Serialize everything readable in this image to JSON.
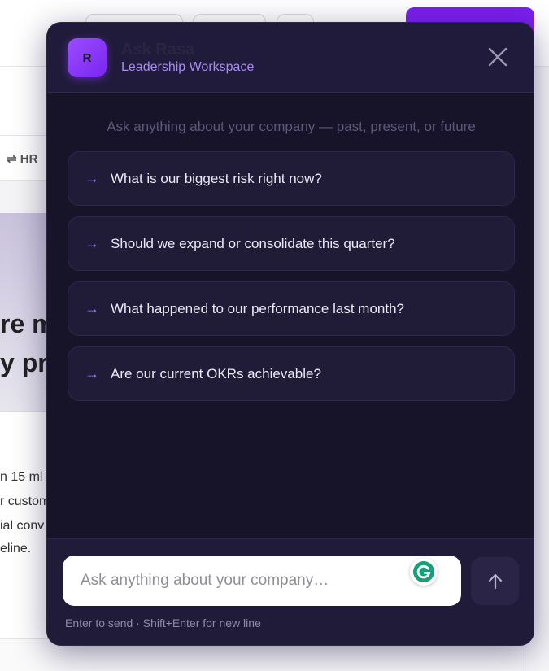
{
  "background": {
    "tab_label": "⇌ HR",
    "hero_lines": [
      "re m",
      "y pr"
    ],
    "body_lines": [
      "n 15 mi",
      "r custom",
      "ial conv",
      "eline."
    ]
  },
  "modal": {
    "avatar_letter": "R",
    "title": "Ask Rasa",
    "subtitle": "Leadership Workspace",
    "intro": "Ask anything about your company — past, present, or future",
    "suggestion_arrow": "→",
    "suggestions": [
      "What is our biggest risk right now?",
      "Should we expand or consolidate this quarter?",
      "What happened to our performance last month?",
      "Are our current OKRs achievable?"
    ],
    "input_placeholder": "Ask anything about your company…",
    "hint": "Enter to send · Shift+Enter for new line"
  },
  "colors": {
    "modal_bg": "#17142a",
    "accent": "#7c1ff0",
    "subtitle": "#a98bf5"
  },
  "icons": {
    "close": "close-icon",
    "send": "arrow-up-icon",
    "suggestion": "arrow-right-icon",
    "grammarly": "grammarly-g-icon"
  }
}
